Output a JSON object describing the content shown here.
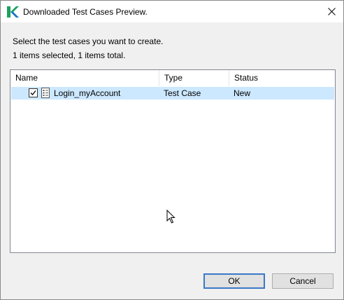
{
  "window": {
    "title": "Downloaded Test Cases Preview.",
    "close_glyph": "✕"
  },
  "messages": {
    "prompt": "Select the test cases you want to create.",
    "summary": "1 items selected, 1 items total."
  },
  "table": {
    "columns": [
      "Name",
      "Type",
      "Status"
    ],
    "rows": [
      {
        "name": "Login_myAccount",
        "type": "Test Case",
        "status": "New",
        "checked": true,
        "icon": "test-case-icon"
      }
    ]
  },
  "buttons": {
    "ok": "OK",
    "cancel": "Cancel"
  },
  "colors": {
    "selection": "#cce8ff",
    "default_button_border": "#3a78c8",
    "logo_green": "#1aa260",
    "logo_blue": "#1a73c8"
  }
}
